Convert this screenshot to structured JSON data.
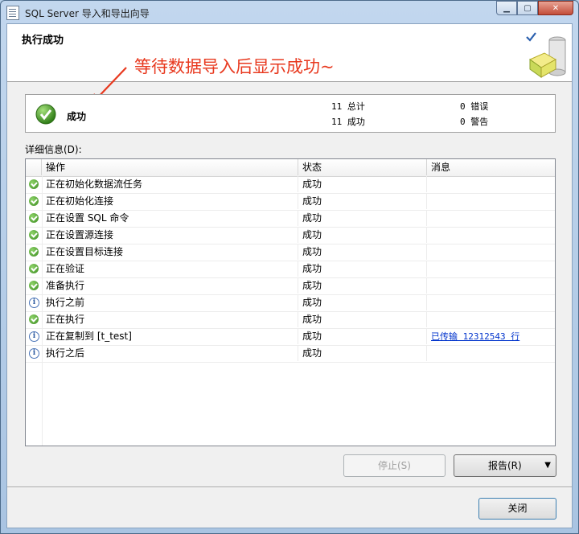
{
  "window": {
    "title": "SQL Server 导入和导出向导"
  },
  "header": {
    "title": "执行成功",
    "annotation": "等待数据导入后显示成功~"
  },
  "summary": {
    "status": "成功",
    "total": "11 总计",
    "success": "11 成功",
    "errors": "0 错误",
    "warnings": "0 警告"
  },
  "details": {
    "label": "详细信息(D):",
    "columns": [
      "操作",
      "状态",
      "消息"
    ],
    "rows": [
      {
        "icon": "success-icon",
        "action": "正在初始化数据流任务",
        "status": "成功",
        "message": ""
      },
      {
        "icon": "success-icon",
        "action": "正在初始化连接",
        "status": "成功",
        "message": ""
      },
      {
        "icon": "success-icon",
        "action": "正在设置 SQL 命令",
        "status": "成功",
        "message": ""
      },
      {
        "icon": "success-icon",
        "action": "正在设置源连接",
        "status": "成功",
        "message": ""
      },
      {
        "icon": "success-icon",
        "action": "正在设置目标连接",
        "status": "成功",
        "message": ""
      },
      {
        "icon": "success-icon",
        "action": "正在验证",
        "status": "成功",
        "message": ""
      },
      {
        "icon": "success-icon",
        "action": "准备执行",
        "status": "成功",
        "message": ""
      },
      {
        "icon": "info-icon",
        "action": "执行之前",
        "status": "成功",
        "message": ""
      },
      {
        "icon": "success-icon",
        "action": "正在执行",
        "status": "成功",
        "message": ""
      },
      {
        "icon": "info-icon",
        "action": "正在复制到 [t_test]",
        "status": "成功",
        "message": "已传输 12312543 行"
      },
      {
        "icon": "info-icon",
        "action": "执行之后",
        "status": "成功",
        "message": ""
      }
    ]
  },
  "buttons": {
    "stop": "停止(S)",
    "report": "报告(R)",
    "close": "关闭"
  },
  "colors": {
    "annotation": "#e8391f",
    "link": "#0033cc",
    "success": "#3a8b1f"
  }
}
